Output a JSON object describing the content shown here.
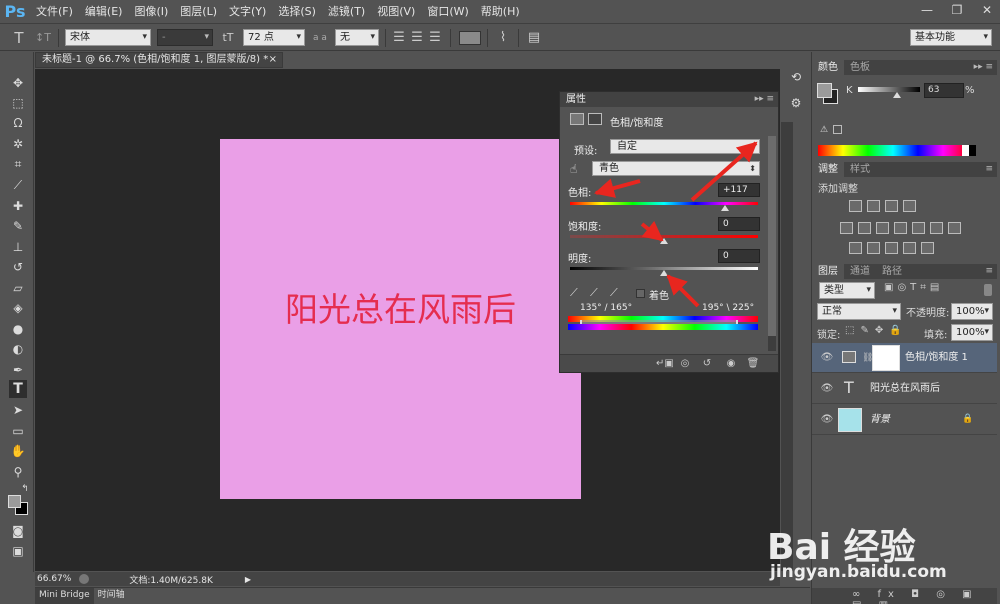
{
  "app": {
    "logo": "Ps"
  },
  "menu": [
    "文件(F)",
    "编辑(E)",
    "图像(I)",
    "图层(L)",
    "文字(Y)",
    "选择(S)",
    "滤镜(T)",
    "视图(V)",
    "窗口(W)",
    "帮助(H)"
  ],
  "window_controls": {
    "minimize": "—",
    "restore": "❐",
    "close": "✕"
  },
  "options": {
    "font_family": "宋体",
    "font_style": "-",
    "font_size": "72 点",
    "antialias_label": "a a",
    "antialias": "无",
    "workspace": "基本功能"
  },
  "document": {
    "tab_title": "未标题-1 @ 66.7% (色相/饱和度 1, 图层蒙版/8) *",
    "tab_close": "×",
    "canvas_text": "阳光总在风雨后",
    "canvas_color": "#ea9fe7",
    "text_color": "#e52d4f"
  },
  "status": {
    "zoom": "66.67%",
    "doc_size": "文档:1.40M/625.8K"
  },
  "bottom_tabs": [
    "Mini Bridge",
    "时间轴"
  ],
  "properties": {
    "tab": "属性",
    "title": "色相/饱和度",
    "preset_label": "预设:",
    "preset": "自定",
    "channel": "青色",
    "hue_label": "色相:",
    "hue_value": "+117",
    "hue_fraction": 0.825,
    "saturation_label": "饱和度:",
    "saturation_value": "0",
    "saturation_fraction": 0.5,
    "lightness_label": "明度:",
    "lightness_value": "0",
    "lightness_fraction": 0.5,
    "colorize_label": "着色",
    "range_left": "135° / 165°",
    "range_right": "195° \\ 225°"
  },
  "color_panel": {
    "tabs": [
      "颜色",
      "色板"
    ],
    "channel_label": "K",
    "value": "63",
    "unit": "%",
    "value_fraction": 0.63
  },
  "adjust_panel": {
    "tabs": [
      "调整",
      "样式"
    ],
    "heading": "添加调整"
  },
  "layers_panel": {
    "tabs": [
      "图层",
      "通道",
      "路径"
    ],
    "filter": "类型",
    "blend_mode": "正常",
    "opacity_label": "不透明度:",
    "opacity": "100%",
    "lock_label": "锁定:",
    "fill_label": "填充:",
    "fill": "100%",
    "layers": [
      {
        "name": "色相/饱和度 1",
        "selected": true
      },
      {
        "name": "阳光总在风雨后",
        "selected": false
      },
      {
        "name": "背景",
        "selected": false
      }
    ],
    "foot_icons": "∞ fx ◘ ◎ ▣ ▤ ▥"
  },
  "watermark": {
    "main": "Bai 经验",
    "url": "jingyan.baidu.com"
  }
}
